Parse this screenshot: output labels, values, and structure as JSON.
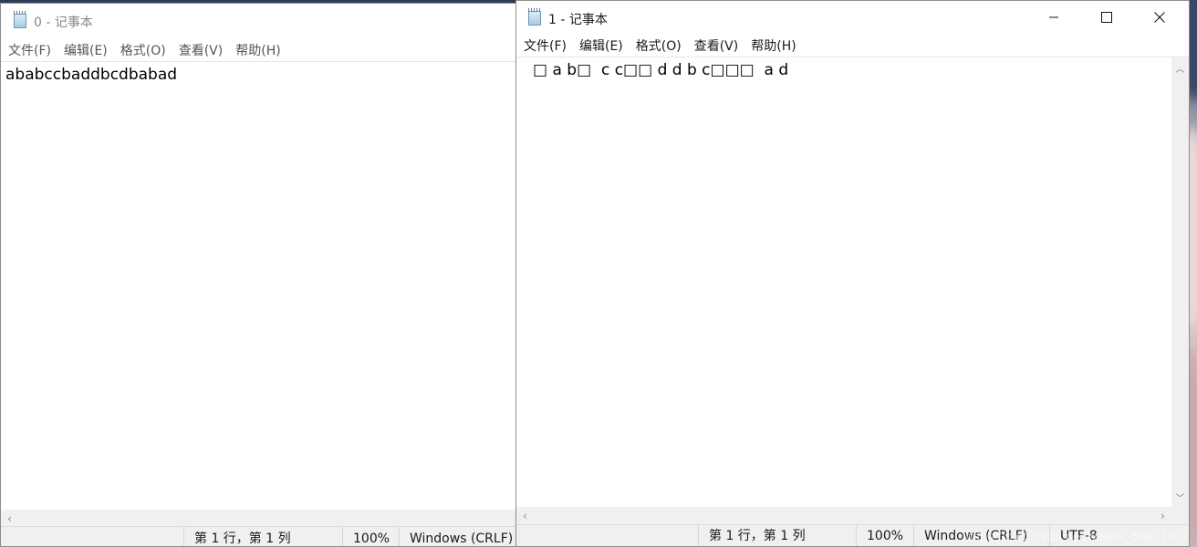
{
  "window0": {
    "title": "0 - 记事本",
    "menu": [
      "文件(F)",
      "编辑(E)",
      "格式(O)",
      "查看(V)",
      "帮助(H)"
    ],
    "content": "ababccbaddbcdbabad",
    "status": {
      "position": "第 1 行，第 1 列",
      "zoom": "100%",
      "line_ending": "Windows (CRLF)"
    },
    "scroll_left_icon": "chevron-left-icon"
  },
  "window1": {
    "title": "1 - 记事本",
    "menu": [
      "文件(F)",
      "编辑(E)",
      "格式(O)",
      "查看(V)",
      "帮助(H)"
    ],
    "content": "□ a b□  c c□□ d d b c□□□  a d",
    "status": {
      "position": "第 1 行，第 1 列",
      "zoom": "100%",
      "line_ending": "Windows (CRLF)",
      "encoding": "UTF-8"
    },
    "caption_buttons": [
      "minimize-icon",
      "maximize-icon",
      "close-icon"
    ]
  },
  "watermark": "https://blog.csdn.net/weixin_50971817"
}
